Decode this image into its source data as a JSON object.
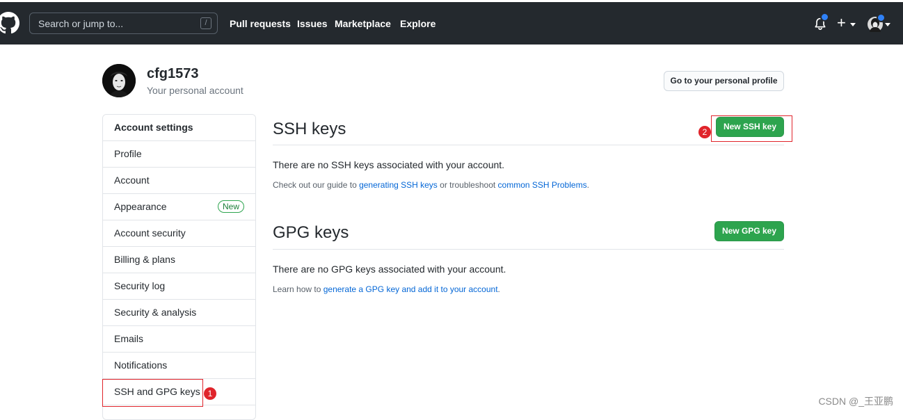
{
  "header": {
    "search_placeholder": "Search or jump to...",
    "search_key": "/",
    "nav": [
      "Pull requests",
      "Issues",
      "Marketplace",
      "Explore"
    ],
    "plus": "+"
  },
  "profile": {
    "username": "cfg1573",
    "subtitle": "Your personal account",
    "profile_button": "Go to your personal profile"
  },
  "sidebar": {
    "heading": "Account settings",
    "items": [
      {
        "label": "Profile"
      },
      {
        "label": "Account"
      },
      {
        "label": "Appearance",
        "badge": "New"
      },
      {
        "label": "Account security"
      },
      {
        "label": "Billing & plans"
      },
      {
        "label": "Security log"
      },
      {
        "label": "Security & analysis"
      },
      {
        "label": "Emails"
      },
      {
        "label": "Notifications"
      },
      {
        "label": "SSH and GPG keys"
      }
    ]
  },
  "ssh": {
    "title": "SSH keys",
    "button": "New SSH key",
    "message": "There are no SSH keys associated with your account.",
    "note_prefix": "Check out our guide to ",
    "note_link1": "generating SSH keys",
    "note_mid": " or troubleshoot ",
    "note_link2": "common SSH Problems",
    "note_suffix": "."
  },
  "gpg": {
    "title": "GPG keys",
    "button": "New GPG key",
    "message": "There are no GPG keys associated with your account.",
    "note_prefix": "Learn how to ",
    "note_link": "generate a GPG key and add it to your account",
    "note_suffix": "."
  },
  "annotations": {
    "step1": "1",
    "step2": "2"
  },
  "watermark": "CSDN @_王亚鹏",
  "colors": {
    "header_bg": "#24292e",
    "green": "#2da44e",
    "link": "#0366d6",
    "annotation_red": "#e0242b"
  }
}
